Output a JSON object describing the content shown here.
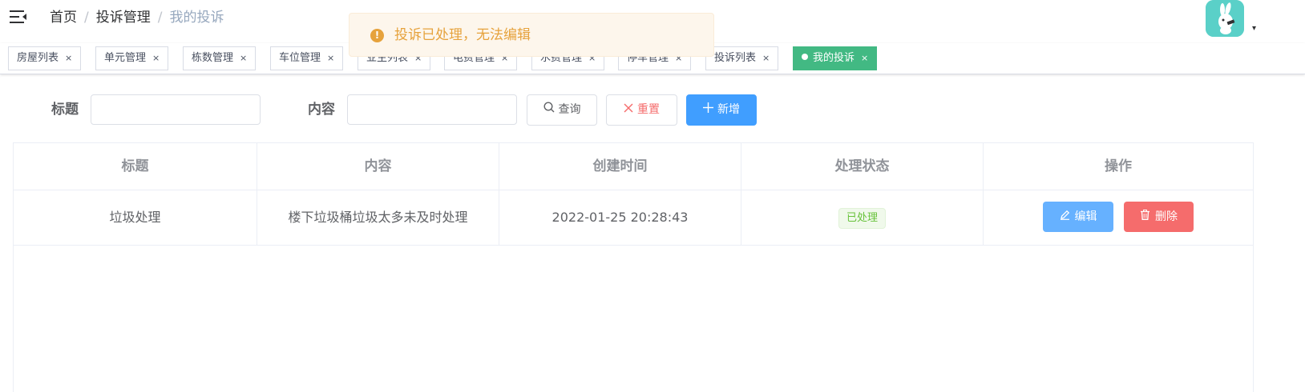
{
  "header": {
    "breadcrumb": [
      "首页",
      "投诉管理",
      "我的投诉"
    ],
    "breadcrumb_separator": "/"
  },
  "toast": {
    "type": "warning",
    "text": "投诉已处理，无法编辑",
    "color": "#e6a23c"
  },
  "tags": [
    {
      "label": "房屋列表",
      "active": false
    },
    {
      "label": "单元管理",
      "active": false
    },
    {
      "label": "栋数管理",
      "active": false
    },
    {
      "label": "车位管理",
      "active": false
    },
    {
      "label": "业主列表",
      "active": false
    },
    {
      "label": "电费管理",
      "active": false
    },
    {
      "label": "水费管理",
      "active": false
    },
    {
      "label": "停车管理",
      "active": false
    },
    {
      "label": "投诉列表",
      "active": false
    },
    {
      "label": "我的投诉",
      "active": true
    }
  ],
  "tag_close": "×",
  "search": {
    "title_label": "标题",
    "title_value": "",
    "content_label": "内容",
    "content_value": "",
    "query_label": "查询",
    "reset_label": "重置",
    "add_label": "新增"
  },
  "table": {
    "columns": [
      "标题",
      "内容",
      "创建时间",
      "处理状态",
      "操作"
    ],
    "rows": [
      {
        "title": "垃圾处理",
        "content": "楼下垃圾桶垃圾太多未及时处理",
        "created": "2022-01-25 20:28:43",
        "status": "已处理",
        "edit_label": "编辑",
        "delete_label": "删除"
      }
    ]
  },
  "colors": {
    "primary": "#409eff",
    "success": "#67c23a",
    "danger": "#f56c6c",
    "active_tag": "#42b983"
  }
}
